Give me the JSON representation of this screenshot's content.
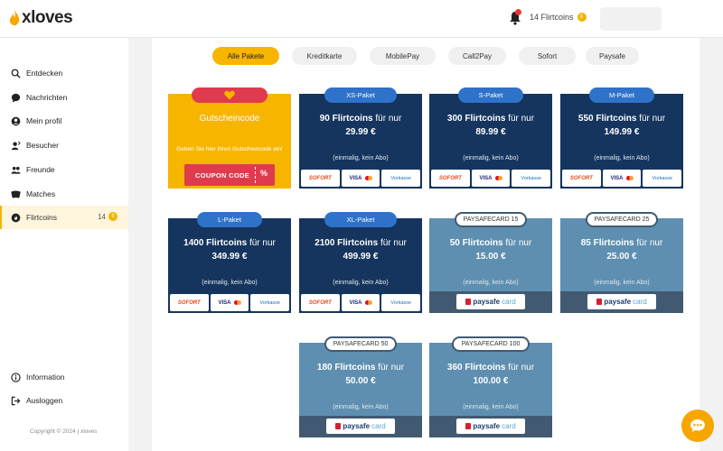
{
  "header": {
    "brand": "xloves",
    "coins_label": "14 Flirtcoins",
    "coin_symbol": "¢",
    "accent": "#f7b500"
  },
  "sidebar": {
    "items": [
      {
        "label": "Entdecken",
        "icon": "search-icon"
      },
      {
        "label": "Nachrichten",
        "icon": "chat-icon"
      },
      {
        "label": "Mein profil",
        "icon": "user-icon"
      },
      {
        "label": "Besucher",
        "icon": "visitor-icon"
      },
      {
        "label": "Freunde",
        "icon": "friends-icon"
      },
      {
        "label": "Matches",
        "icon": "matches-icon"
      },
      {
        "label": "Flirtcoins",
        "icon": "flirtcoin-icon",
        "count": "14",
        "active": true
      }
    ],
    "bottom_items": [
      {
        "label": "Information",
        "icon": "info-icon"
      },
      {
        "label": "Ausloggen",
        "icon": "logout-icon"
      }
    ],
    "copyright": "Copyright © 2024 | xloves"
  },
  "tabs": [
    "Alle Pakete",
    "Kreditkarte",
    "MobilePay",
    "Call2Pay",
    "Sofort",
    "Paysafe"
  ],
  "voucher": {
    "title": "Gutscheincode",
    "subtitle": "Geben Sie hier Ihren Gutscheincode ein!",
    "button": "COUPON CODE",
    "percent": "%"
  },
  "packages": [
    {
      "tag": "XS-Paket",
      "coins": "90 Flirtcoins",
      "suffix": "für nur",
      "price": "29.99 €",
      "note": "(einmalig, kein Abo)"
    },
    {
      "tag": "S-Paket",
      "coins": "300 Flirtcoins",
      "suffix": "für nur",
      "price": "89.99 €",
      "note": "(einmalig, kein Abo)"
    },
    {
      "tag": "M-Paket",
      "coins": "550 Flirtcoins",
      "suffix": "für nur",
      "price": "149.99 €",
      "note": "(einmalig, kein Abo)"
    },
    {
      "tag": "L-Paket",
      "coins": "1400 Flirtcoins",
      "suffix": "für nur",
      "price": "349.99 €",
      "note": "(einmalig, kein Abo)"
    },
    {
      "tag": "XL-Paket",
      "coins": "2100 Flirtcoins",
      "suffix": "für nur",
      "price": "499.99 €",
      "note": "(einmalig, kein Abo)"
    }
  ],
  "payment_badges": {
    "sofort": "SOFORT",
    "visa": "VISA",
    "vorkasse": "Vorkasse"
  },
  "paysafe": [
    {
      "tag": "PAYSAFECARD 15",
      "coins": "50 Flirtcoins",
      "suffix": "für nur",
      "price": "15.00 €",
      "note": "(einmalig, kein Abo)"
    },
    {
      "tag": "PAYSAFECARD 25",
      "coins": "85 Flirtcoins",
      "suffix": "für nur",
      "price": "25.00 €",
      "note": "(einmalig, kein Abo)"
    },
    {
      "tag": "PAYSAFECARD 50",
      "coins": "180 Flirtcoins",
      "suffix": "für nur",
      "price": "50.00 €",
      "note": "(einmalig, kein Abo)"
    },
    {
      "tag": "PAYSAFECARD 100",
      "coins": "360 Flirtcoins",
      "suffix": "für nur",
      "price": "100.00 €",
      "note": "(einmalig, kein Abo)"
    }
  ],
  "paysafe_logo": {
    "part1": "paysafe",
    "part2": "card"
  }
}
